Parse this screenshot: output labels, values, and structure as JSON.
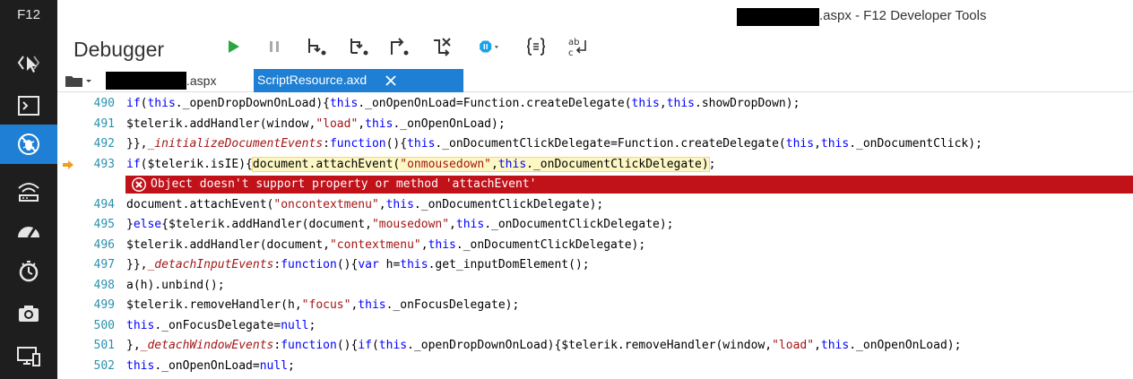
{
  "rail": {
    "title": "F12",
    "tools": [
      {
        "icon": "dom-explorer-icon"
      },
      {
        "icon": "console-icon"
      },
      {
        "icon": "debugger-icon",
        "active": true
      },
      {
        "icon": "network-icon"
      },
      {
        "icon": "performance-icon"
      },
      {
        "icon": "memory-icon"
      },
      {
        "icon": "emulation-icon"
      },
      {
        "icon": "device-icon"
      }
    ]
  },
  "window": {
    "title_suffix": ".aspx - F12 Developer Tools"
  },
  "toolbar": {
    "tool_name": "Debugger",
    "buttons": [
      {
        "icon": "continue-icon"
      },
      {
        "icon": "break-icon"
      },
      {
        "icon": "step-into-icon"
      },
      {
        "icon": "step-over-icon"
      },
      {
        "icon": "step-out-icon"
      },
      {
        "icon": "break-on-new-worker-icon"
      },
      {
        "icon": "exception-behavior-icon"
      },
      {
        "icon": "pretty-print-icon"
      },
      {
        "icon": "word-wrap-icon"
      }
    ]
  },
  "tabs": [
    {
      "label": ".aspx",
      "active": false
    },
    {
      "label": "ScriptResource.axd",
      "active": true
    }
  ],
  "colors": {
    "accent": "#1e7fd4",
    "error": "#c1121a",
    "rail": "#1e1e1e"
  },
  "editor": {
    "lines": [
      {
        "n": "490",
        "t": [
          [
            "kw",
            "if"
          ],
          [
            "",
            "("
          ],
          [
            "kw",
            "this"
          ],
          [
            "",
            "._openDropDownOnLoad){"
          ],
          [
            "kw",
            "this"
          ],
          [
            "",
            "._onOpenOnLoad=Function.createDelegate("
          ],
          [
            "kw",
            "this"
          ],
          [
            "",
            ","
          ],
          [
            "kw",
            "this"
          ],
          [
            "",
            ".showDropDown);"
          ]
        ]
      },
      {
        "n": "491",
        "t": [
          [
            "",
            "$telerik.addHandler(window,"
          ],
          [
            "str",
            "\"load\""
          ],
          [
            "",
            ","
          ],
          [
            "kw",
            "this"
          ],
          [
            "",
            "._onOpenOnLoad);"
          ]
        ]
      },
      {
        "n": "492",
        "t": [
          [
            "",
            "}},"
          ],
          [
            "fn",
            "_initializeDocumentEvents"
          ],
          [
            "",
            ":"
          ],
          [
            "kw",
            "function"
          ],
          [
            "",
            "(){"
          ],
          [
            "kw",
            "this"
          ],
          [
            "",
            "._onDocumentClickDelegate=Function.createDelegate("
          ],
          [
            "kw",
            "this"
          ],
          [
            "",
            ","
          ],
          [
            "kw",
            "this"
          ],
          [
            "",
            "._onDocumentClick);"
          ]
        ]
      },
      {
        "n": "493",
        "current": true,
        "t": [
          [
            "kw",
            "if"
          ],
          [
            "",
            "($telerik.isIE){"
          ],
          [
            "hl",
            "document.attachEvent(|str:\"onmousedown\"|,|kw:this|._onDocumentClickDelegate)"
          ],
          [
            "",
            ";"
          ]
        ]
      },
      {
        "n": "494",
        "t": [
          [
            "",
            "document.attachEvent("
          ],
          [
            "str",
            "\"oncontextmenu\""
          ],
          [
            "",
            ","
          ],
          [
            "kw",
            "this"
          ],
          [
            "",
            "._onDocumentClickDelegate);"
          ]
        ]
      },
      {
        "n": "495",
        "t": [
          [
            "",
            "}"
          ],
          [
            "kw",
            "else"
          ],
          [
            "",
            "{$telerik.addHandler(document,"
          ],
          [
            "str",
            "\"mousedown\""
          ],
          [
            "",
            ","
          ],
          [
            "kw",
            "this"
          ],
          [
            "",
            "._onDocumentClickDelegate);"
          ]
        ]
      },
      {
        "n": "496",
        "t": [
          [
            "",
            "$telerik.addHandler(document,"
          ],
          [
            "str",
            "\"contextmenu\""
          ],
          [
            "",
            ","
          ],
          [
            "kw",
            "this"
          ],
          [
            "",
            "._onDocumentClickDelegate);"
          ]
        ]
      },
      {
        "n": "497",
        "t": [
          [
            "",
            "}},"
          ],
          [
            "fn",
            "_detachInputEvents"
          ],
          [
            "",
            ":"
          ],
          [
            "kw",
            "function"
          ],
          [
            "",
            "(){"
          ],
          [
            "kw",
            "var"
          ],
          [
            "",
            " h="
          ],
          [
            "kw",
            "this"
          ],
          [
            "",
            ".get_inputDomElement();"
          ]
        ]
      },
      {
        "n": "498",
        "t": [
          [
            "",
            "a(h).unbind();"
          ]
        ]
      },
      {
        "n": "499",
        "t": [
          [
            "",
            "$telerik.removeHandler(h,"
          ],
          [
            "str",
            "\"focus\""
          ],
          [
            "",
            ","
          ],
          [
            "kw",
            "this"
          ],
          [
            "",
            "._onFocusDelegate);"
          ]
        ]
      },
      {
        "n": "500",
        "t": [
          [
            "kw",
            "this"
          ],
          [
            "",
            "._onFocusDelegate="
          ],
          [
            "kw",
            "null"
          ],
          [
            "",
            ";"
          ]
        ]
      },
      {
        "n": "501",
        "t": [
          [
            "",
            "},"
          ],
          [
            "fn",
            "_detachWindowEvents"
          ],
          [
            "",
            ":"
          ],
          [
            "kw",
            "function"
          ],
          [
            "",
            "(){"
          ],
          [
            "kw",
            "if"
          ],
          [
            "",
            "("
          ],
          [
            "kw",
            "this"
          ],
          [
            "",
            "._openDropDownOnLoad){$telerik.removeHandler(window,"
          ],
          [
            "str",
            "\"load\""
          ],
          [
            "",
            ","
          ],
          [
            "kw",
            "this"
          ],
          [
            "",
            "._onOpenOnLoad);"
          ]
        ]
      },
      {
        "n": "502",
        "t": [
          [
            "kw",
            "this"
          ],
          [
            "",
            "._onOpenOnLoad="
          ],
          [
            "kw",
            "null"
          ],
          [
            "",
            ";"
          ]
        ]
      }
    ],
    "error": {
      "after_line": "493",
      "message": "Object doesn't support property or method 'attachEvent'"
    }
  }
}
